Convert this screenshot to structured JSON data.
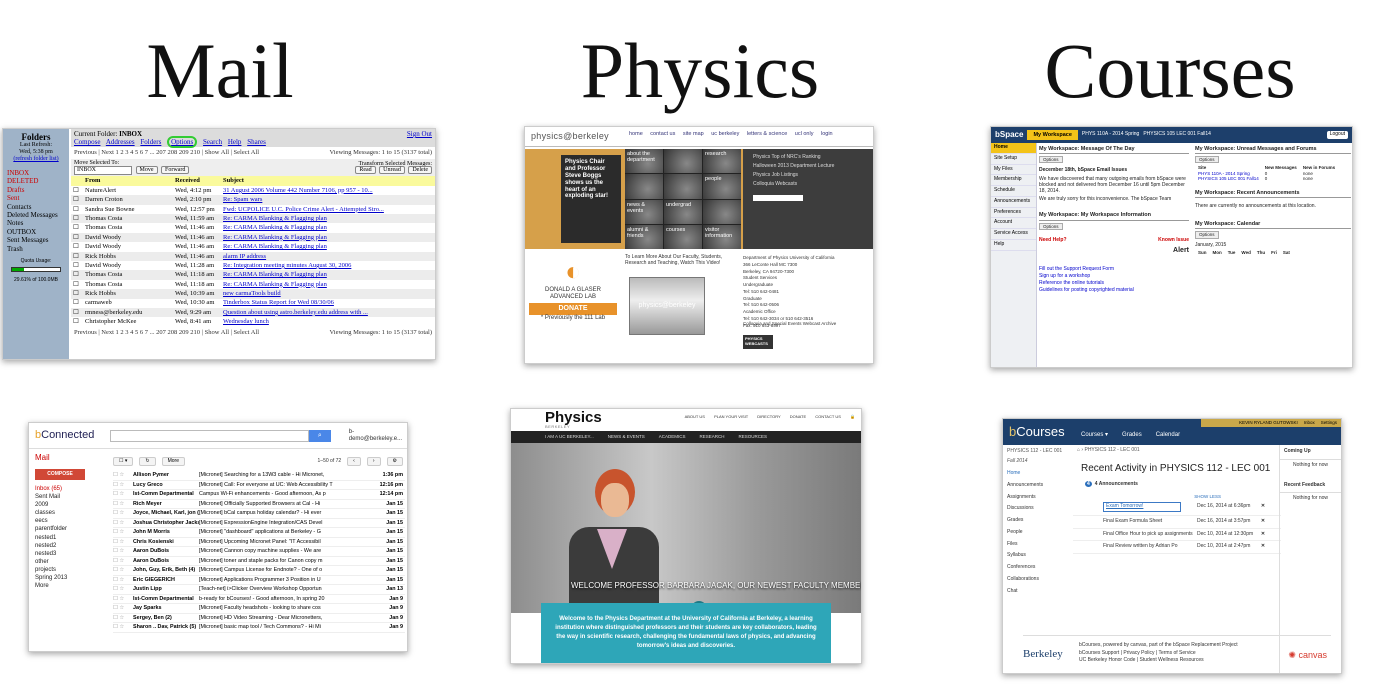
{
  "headings": {
    "mail": "Mail",
    "physics": "Physics",
    "courses": "Courses"
  },
  "old_mail": {
    "folders_title": "Folders",
    "last_refresh": "Last Refresh:",
    "refresh_time": "Wed, 5:38 pm",
    "refresh_link": "(refresh folder list)",
    "folders": [
      "INBOX",
      "DELETED",
      "Drafts",
      "Sent",
      "Contacts",
      "Deleted Messages",
      "Notes",
      "OUTBOX",
      "Sent Messages",
      "Trash"
    ],
    "quota_label": "Quota Usage:",
    "quota_value": "29.61% of 100.0MB",
    "current_folder_label": "Current Folder:",
    "current_folder": "INBOX",
    "sign_out": "Sign Out",
    "nav": [
      "Compose",
      "Addresses",
      "Folders",
      "Options",
      "Search",
      "Help",
      "Shares"
    ],
    "pager_text": "Previous | Next 1 2 3 4 5 6 7 ... 207 208 209 210 | Show All | Select All",
    "viewing": "Viewing Messages: 1 to 15 (3137 total)",
    "move_selected": "Move Selected To:",
    "move_target": "INBOX",
    "move_btn": "Move",
    "forward_btn": "Forward",
    "transform": "Transform Selected Messages:",
    "read_btn": "Read",
    "unread_btn": "Unread",
    "delete_btn": "Delete",
    "col_from": "From",
    "col_received": "Received",
    "col_subject": "Subject",
    "messages": [
      {
        "from": "NatureAlert",
        "received": "Wed, 4:12 pm",
        "subject": "31 August 2006 Volume 442 Number 7106, pp 957 - 10..."
      },
      {
        "from": "Darren Croton",
        "received": "Wed, 2:10 pm",
        "subject": "Re: Spam wars"
      },
      {
        "from": "Sandra Sue Bowne",
        "received": "Wed, 12:57 pm",
        "subject": "Fwd: UCPOLICE U.C. Police Crime Alert - Attempted Stro..."
      },
      {
        "from": "Thomas Costa",
        "received": "Wed, 11:59 am",
        "subject": "Re: CARMA Blanking & Flagging plan"
      },
      {
        "from": "Thomas Costa",
        "received": "Wed, 11:46 am",
        "subject": "Re: CARMA Blanking & Flagging plan"
      },
      {
        "from": "David Woody",
        "received": "Wed, 11:46 am",
        "subject": "Re: CARMA Blanking & Flagging plan"
      },
      {
        "from": "David Woody",
        "received": "Wed, 11:46 am",
        "subject": "Re: CARMA Blanking & Flagging plan"
      },
      {
        "from": "Rick Hobbs",
        "received": "Wed, 11:46 am",
        "subject": "alarm IP address"
      },
      {
        "from": "David Woody",
        "received": "Wed, 11:28 am",
        "subject": "Re: Integration meeting minutes August 30, 2006"
      },
      {
        "from": "Thomas Costa",
        "received": "Wed, 11:18 am",
        "subject": "Re: CARMA Blanking & Flagging plan"
      },
      {
        "from": "Thomas Costa",
        "received": "Wed, 11:18 am",
        "subject": "Re: CARMA Blanking & Flagging plan"
      },
      {
        "from": "Rick Hobbs",
        "received": "Wed, 10:39 am",
        "subject": "new carmaTools build"
      },
      {
        "from": "carmaweb",
        "received": "Wed, 10:30 am",
        "subject": "Tinderbox Status Report for Wed 08/30/06"
      },
      {
        "from": "rmness@berkeley.edu",
        "received": "Wed, 9:29 am",
        "subject": "Question about using astro.berkeley.edu address with ..."
      },
      {
        "from": "Christopher McKee",
        "received": "Wed, 8:41 am",
        "subject": "Wednesday lunch"
      }
    ]
  },
  "physics_old": {
    "logo": "physics@berkeley",
    "nav": [
      "home",
      "contact us",
      "site map",
      "uc berkeley",
      "letters & science",
      "ucl only",
      "login"
    ],
    "promo": "Physics Chair and Professor Steve Boggs shows us the heart of an exploding star!",
    "grid": [
      "about the department",
      "",
      "research",
      "",
      "",
      "people",
      "news & events",
      "undergrad",
      "",
      "alumni & friends",
      "courses",
      "visitor information"
    ],
    "side_links": [
      "Physics Top of NRC's Ranking",
      "Halloween 2013 Department Lecture",
      "Physics Job Listings",
      "Colloquia Webcasts"
    ],
    "glaser_logo": "DONALD A GLASER ADVANCED LAB",
    "donate": "DONATE",
    "glaser_note": "* Previously the 111 Lab",
    "mid_text": "To Learn More About Our Faculty, Students, Research and Teaching, Watch This Video!",
    "video_label": "physics@berkeley",
    "address": [
      "Department of Physics University of California",
      "366 LeConte Hall MC 7300",
      "Berkeley, CA 94720-7300",
      "Student Services",
      "Undergraduate",
      "Tel: 510 642-0481",
      "Graduate",
      "Tel: 510 642-0506",
      "Academic Office",
      "Tel: 510 642-3034 or 510 642-3516",
      "Fax: 510 643-8497"
    ],
    "colloquia": "Colloquia and Special Events Webcast Archive",
    "webcasts": "PHYSICS WEBCASTS"
  },
  "bspace": {
    "brand": "bSpace",
    "tabs": [
      "My Workspace",
      "PHYS 110A - 2014 Spring",
      "PHYSICS 105 LEC 001 Fall14"
    ],
    "logout": "Logout",
    "menu": [
      "Home",
      "Site Setup",
      "My Files",
      "Membership",
      "Schedule",
      "Announcements",
      "Preferences",
      "Account",
      "Service Access",
      "Help"
    ],
    "motd_title": "My Workspace: Message Of The Day",
    "options": "Options",
    "motd_head": "December 18th, bSpace Email Issues",
    "motd_body": "We have discovered that many outgoing emails from bSpace were blocked and not delivered from December 16 until 5pm December 18, 2014.",
    "motd_sign": "We are truly sorry for this inconvenience. The bSpace Team",
    "info_title": "My Workspace: My Workspace Information",
    "need_help": "Need Help?",
    "known_issue": "Known Issue",
    "alert": "Alert",
    "help_links": [
      "Fill out the Support Request Form",
      "Sign up for a workshop",
      "Reference the online tutorials",
      "Guidelines for posting copyrighted material"
    ],
    "unread_title": "My Workspace: Unread Messages and Forums",
    "unread_cols": [
      "Site",
      "New Messages",
      "New in Forums"
    ],
    "unread_rows": [
      [
        "PHYS 110A - 2014 Spring",
        "0",
        "none"
      ],
      [
        "PHYSICS 105 LEC 001 Fall14",
        "0",
        "none"
      ]
    ],
    "ann_title": "My Workspace: Recent Announcements",
    "ann_empty": "There are currently no announcements at this location.",
    "cal_title": "My Workspace: Calendar",
    "cal_month": "January, 2015",
    "cal_days": [
      "Sun",
      "Mon",
      "Tue",
      "Wed",
      "Thu",
      "Fri",
      "Sat"
    ]
  },
  "bconnected": {
    "logo_b": "b",
    "logo_rest": "Connected",
    "account": "b-demo@berkeley.e...",
    "mail": "Mail",
    "compose": "COMPOSE",
    "folders": [
      "Inbox (65)",
      "Sent Mail",
      "2009",
      "classes",
      "eecs",
      "parentfolder",
      "nested1",
      "nested2",
      "nested3",
      "other",
      "projects",
      "Spring 2013",
      "More"
    ],
    "more_btn": "More",
    "count": "1–50 of 72",
    "messages": [
      {
        "from": "Allison Pymer",
        "subject": "[Micronet] Searching for a 13W3 cable - Hi Micronet,",
        "date": "1:36 pm"
      },
      {
        "from": "Lucy Greco",
        "subject": "[Micronet] Call: For everyone at UC: Web Accessibility T",
        "date": "12:16 pm"
      },
      {
        "from": "Ist-Comm Departmental",
        "subject": "Campus Wi-Fi enhancements - Good afternoon, As p",
        "date": "12:14 pm"
      },
      {
        "from": "Rich Meyer",
        "subject": "[Micronet] Officially Supported Browsers at Cal - Hi",
        "date": "Jan 15"
      },
      {
        "from": "Joyce, Michael, Karl, jon (5)",
        "subject": "[Micronet] bCal campus holiday calendar? - Hi ever",
        "date": "Jan 15"
      },
      {
        "from": "Joshua Christopher Jacks.",
        "subject": "[Micronet] ExpressionEngine Integration/CAS Devel",
        "date": "Jan 15"
      },
      {
        "from": "John M Morris",
        "subject": "[Micronet] \"dashboard\" applications at Berkeley - G",
        "date": "Jan 15"
      },
      {
        "from": "Chris Kosienski",
        "subject": "[Micronet] Upcoming Micronet Panel: \"IT Accessibil",
        "date": "Jan 15"
      },
      {
        "from": "Aaron DuBois",
        "subject": "[Micronet] Cannon copy machine supplies - We are",
        "date": "Jan 15"
      },
      {
        "from": "Aaron DuBois",
        "subject": "[Micronet] toner and staple packs for Canon copy m",
        "date": "Jan 15"
      },
      {
        "from": "John, Guy, Erik, Beth (4)",
        "subject": "[Micronet] Campus License for Endnote? - One of o",
        "date": "Jan 15"
      },
      {
        "from": "Eric GIEGERICH",
        "subject": "[Micronet] Applications Programmer 3 Position in U",
        "date": "Jan 15"
      },
      {
        "from": "Justin Lipp",
        "subject": "[Teach-net] i>Clicker Overview Workshop Opportun",
        "date": "Jan 13"
      },
      {
        "from": "Ist-Comm Departmental",
        "subject": "b-ready for bCourses! - Good afternoon, In spring 20",
        "date": "Jan 9"
      },
      {
        "from": "Jay Sparks",
        "subject": "[Micronet] Faculty headshots - looking to share cos",
        "date": "Jan 9"
      },
      {
        "from": "Sergey, Ben (2)",
        "subject": "[Micronet] HD Video Streaming - Dear Micronetters,",
        "date": "Jan 9"
      },
      {
        "from": "Sharon .. Dav, Patrick (5)",
        "subject": "[Micronet] basic map tool / Tech Commons? - Hi Mi",
        "date": "Jan 9"
      }
    ]
  },
  "physics_new": {
    "title": "Physics",
    "subtitle": "BERKELEY",
    "util": [
      "ABOUT US",
      "PLAN YOUR VISIT",
      "DIRECTORY",
      "DONATE",
      "CONTACT US"
    ],
    "nav": [
      "I AM A UC BERKELEY...",
      "NEWS & EVENTS",
      "ACADEMICS",
      "RESEARCH",
      "RESOURCES"
    ],
    "caption": "WELCOME PROFESSOR BARBARA JACAK, OUR NEWEST FACULTY MEMBER!",
    "intro": "Welcome to the Physics Department at the University of California at Berkeley, a learning institution where distinguished professors and their students are key collaborators, leading the way in scientific research, challenging the fundamental laws of physics, and advancing tomorrow's ideas and discoveries."
  },
  "bcourses": {
    "user": "KEVIN RYLAND GUTOWSKI",
    "strip": [
      "Inbox",
      "Settings"
    ],
    "brand_b": "b",
    "brand_rest": "Courses",
    "tnav": [
      "Courses ▾",
      "Grades",
      "Calendar"
    ],
    "course_title": "PHYSICS 112 - LEC 001",
    "term": "Fall 2014",
    "left_nav": [
      "Home",
      "Announcements",
      "Assignments",
      "Discussions",
      "Grades",
      "People",
      "Files",
      "Syllabus",
      "Conferences",
      "Collaborations",
      "Chat"
    ],
    "crumb": "PHYSICS 112 - LEC 001",
    "recent_title": "Recent Activity in PHYSICS 112 - LEC 001",
    "ann_count_badge": "4",
    "ann_count": "4 Announcements",
    "show_less": "SHOW LESS",
    "items": [
      {
        "name": "Exam Tomorrow!",
        "date": "Dec 16, 2014 at 6:36pm"
      },
      {
        "name": "Final Exam Formula Sheet",
        "date": "Dec 16, 2014 at 3:57pm"
      },
      {
        "name": "Final Office Hour to pick up assignments",
        "date": "Dec 10, 2014 at 12:30pm"
      },
      {
        "name": "Final Review written by Adrian Po",
        "date": "Dec 10, 2014 at 2:47pm"
      }
    ],
    "coming_up": "Coming Up",
    "nothing_1": "Nothing for now",
    "recent_feedback": "Recent Feedback",
    "nothing_2": "Nothing for now",
    "footer_brand": "Berkeley",
    "footer_lines": [
      "bCourses, powered by canvas, part of the bSpace Replacement Project",
      "bCourses Support | Privacy Policy | Terms of Service",
      "UC Berkeley Honor Code | Student Wellness Resources"
    ],
    "canvas": "canvas"
  }
}
